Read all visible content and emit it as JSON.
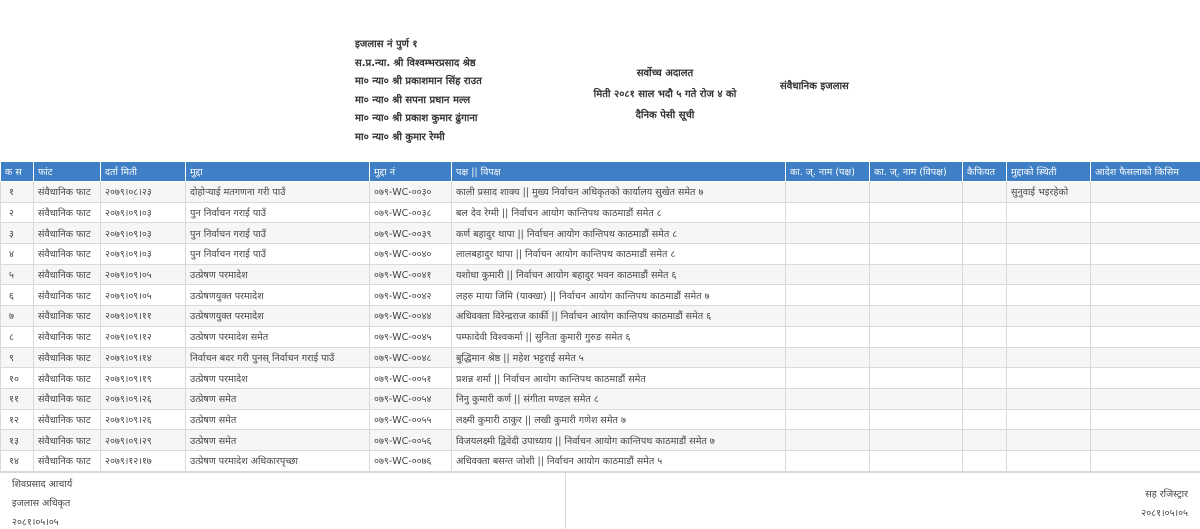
{
  "header": {
    "bench_lines": [
      "इजलास नं पुर्ण १",
      "स.प्र.न्या. श्री विश्वम्भरप्रसाद श्रेष्ठ",
      "मा० न्या० श्री प्रकाशमान सिंह राउत",
      "मा० न्या० श्री सपना प्रधान मल्ल",
      "मा० न्या० श्री प्रकाश कुमार ढुंगाना",
      "मा० न्या० श्री कुमार रेग्मी"
    ],
    "court_name": "सर्वोच्च अदालत",
    "date_line": "मिती २०८१ साल भदौ ५ गते रोज ४ को",
    "list_title": "दैनिक पेसी सूची",
    "bench_type": "संवैधानिक इजलास"
  },
  "columns": [
    "क स",
    "फांट",
    "दर्ता मिती",
    "मुद्दा",
    "मुद्दा नं",
    "पक्ष || विपक्ष",
    "का. ज्. नाम (पक्ष)",
    "का. ज्. नाम (विपक्ष)",
    "कैफियत",
    "मुद्दाको स्थिती",
    "आदेश फैसलाको किसिम"
  ],
  "rows": [
    {
      "sn": "१",
      "font": "संवैधानिक फाट",
      "date": "२०७९।०८।२३",
      "case": "दोहोऱ्याई मतगणना गरी पाउँ",
      "case_no": "०७९-WC-००३०",
      "parties": "काली प्रसाद शाक्य  ||  मुख्य निर्वाचन अधिकृतको कार्यालय सुखेत समेत ७",
      "adv_p": "",
      "adv_v": "",
      "remark": "",
      "status": "सुनुवाई भइरहेको",
      "order": ""
    },
    {
      "sn": "२",
      "font": "संवैधानिक फाट",
      "date": "२०७९।०९।०३",
      "case": "पुन निर्वाचन गराई पाउँ",
      "case_no": "०७९-WC-००३८",
      "parties": "बल देव रेग्मी  ||  निर्वाचन आयोग कान्तिपथ काठमाडौं समेत ८",
      "adv_p": "",
      "adv_v": "",
      "remark": "",
      "status": "",
      "order": ""
    },
    {
      "sn": "३",
      "font": "संवैधानिक फाट",
      "date": "२०७९।०९।०३",
      "case": "पुन निर्वाचन गराई पाउँ",
      "case_no": "०७९-WC-००३९",
      "parties": "कर्ण बहादुर थापा  ||  निर्वाचन आयोग कान्तिपथ काठमाडौं समेत ८",
      "adv_p": "",
      "adv_v": "",
      "remark": "",
      "status": "",
      "order": ""
    },
    {
      "sn": "४",
      "font": "संवैधानिक फाट",
      "date": "२०७९।०९।०३",
      "case": "पुन निर्वाचन गराई पाउँ",
      "case_no": "०७९-WC-००४०",
      "parties": "लालबहादुर थापा  ||  निर्वाचन आयोग कान्तिपथ काठमाडौं समेत ८",
      "adv_p": "",
      "adv_v": "",
      "remark": "",
      "status": "",
      "order": ""
    },
    {
      "sn": "५",
      "font": "संवैधानिक फाट",
      "date": "२०७९।०९।०५",
      "case": "उत्प्रेषण परमादेश",
      "case_no": "०७९-WC-००४१",
      "parties": "यशोधा कुमारी  ||  निर्वाचन आयोग बहादुर भवन काठमाडौं समेत ६",
      "adv_p": "",
      "adv_v": "",
      "remark": "",
      "status": "",
      "order": ""
    },
    {
      "sn": "६",
      "font": "संवैधानिक फाट",
      "date": "२०७९।०९।०५",
      "case": "उत्प्रेषणयुक्त परमादेश",
      "case_no": "०७९-WC-००४२",
      "parties": "लहरु माया जिमि (याक्खा)  ||  निर्वाचन आयोग कान्तिपथ काठमाडौं समेत ७",
      "adv_p": "",
      "adv_v": "",
      "remark": "",
      "status": "",
      "order": ""
    },
    {
      "sn": "७",
      "font": "संवैधानिक फाट",
      "date": "२०७९।०९।११",
      "case": "उत्प्रेषणयुक्त परमादेश",
      "case_no": "०७९-WC-००४४",
      "parties": "अधिवक्ता विरेन्द्रराज कार्की  ||  निर्वाचन आयोग कान्तिपथ काठमाडौं समेत ६",
      "adv_p": "",
      "adv_v": "",
      "remark": "",
      "status": "",
      "order": ""
    },
    {
      "sn": "८",
      "font": "संवैधानिक फाट",
      "date": "२०७९।०९।१२",
      "case": "उत्प्रेषण परमादेश समेत",
      "case_no": "०७९-WC-००४५",
      "parties": "पम्फादेवी विश्वकर्मा  ||  सुनिता कुमारी गुरुङ समेत ६",
      "adv_p": "",
      "adv_v": "",
      "remark": "",
      "status": "",
      "order": ""
    },
    {
      "sn": "९",
      "font": "संवैधानिक फाट",
      "date": "२०७९।०९।१४",
      "case": "निर्वाचन बदर गरी पुनस् निर्वाचन गराई पाउँ",
      "case_no": "०७९-WC-००४८",
      "parties": "बुद्धिमान श्रेष्ठ  ||  महेश भट्टराई समेत ५",
      "adv_p": "",
      "adv_v": "",
      "remark": "",
      "status": "",
      "order": ""
    },
    {
      "sn": "१०",
      "font": "संवैधानिक फाट",
      "date": "२०७९।०९।१९",
      "case": "उत्प्रेषण परमादेश",
      "case_no": "०७९-WC-००५१",
      "parties": "प्रशन्न शर्मा  ||  निर्वाचन आयोग कान्तिपथ काठमाडौं समेत",
      "adv_p": "",
      "adv_v": "",
      "remark": "",
      "status": "",
      "order": ""
    },
    {
      "sn": "११",
      "font": "संवैधानिक फाट",
      "date": "२०७९।०९।२६",
      "case": "उत्प्रेषण समेत",
      "case_no": "०७९-WC-००५४",
      "parties": "निनु कुमारी कर्ण  ||  संगीता मण्डल समेत ८",
      "adv_p": "",
      "adv_v": "",
      "remark": "",
      "status": "",
      "order": ""
    },
    {
      "sn": "१२",
      "font": "संवैधानिक फाट",
      "date": "२०७९।०९।२६",
      "case": "उत्प्रेषण समेत",
      "case_no": "०७९-WC-००५५",
      "parties": "लक्ष्मी कुमारी ठाकुर  ||  लखी कुमारी गणेश समेत ७",
      "adv_p": "",
      "adv_v": "",
      "remark": "",
      "status": "",
      "order": ""
    },
    {
      "sn": "१३",
      "font": "संवैधानिक फाट",
      "date": "२०७९।०९।२९",
      "case": "उत्प्रेषण समेत",
      "case_no": "०७९-WC-००५६",
      "parties": "विजयलक्ष्मी द्विवेदी उपाध्याय  ||  निर्वाचन आयोग कान्तिपथ काठमाडौं समेत ७",
      "adv_p": "",
      "adv_v": "",
      "remark": "",
      "status": "",
      "order": ""
    },
    {
      "sn": "१४",
      "font": "संवैधानिक फाट",
      "date": "२०७९।१२।१७",
      "case": "उत्प्रेषण परमादेश अधिकारपृच्छा",
      "case_no": "०७९-WC-००७६",
      "parties": "अधिवक्ता बसन्त जोशी  ||  निर्वाचन आयोग काठमाडौं समेत ५",
      "adv_p": "",
      "adv_v": "",
      "remark": "",
      "status": "",
      "order": ""
    }
  ],
  "footer": {
    "officer_name": "शिवप्रसाद आचार्य",
    "officer_title": "इजलास अधिकृत",
    "officer_date": "२०८१।०५।०५",
    "registrar_title": "सह रजिस्ट्रार",
    "registrar_date": "२०८१।०५।०५"
  },
  "colors": {
    "header_bg": "#3e7fc6",
    "row_alt": "#f6f6f6"
  }
}
